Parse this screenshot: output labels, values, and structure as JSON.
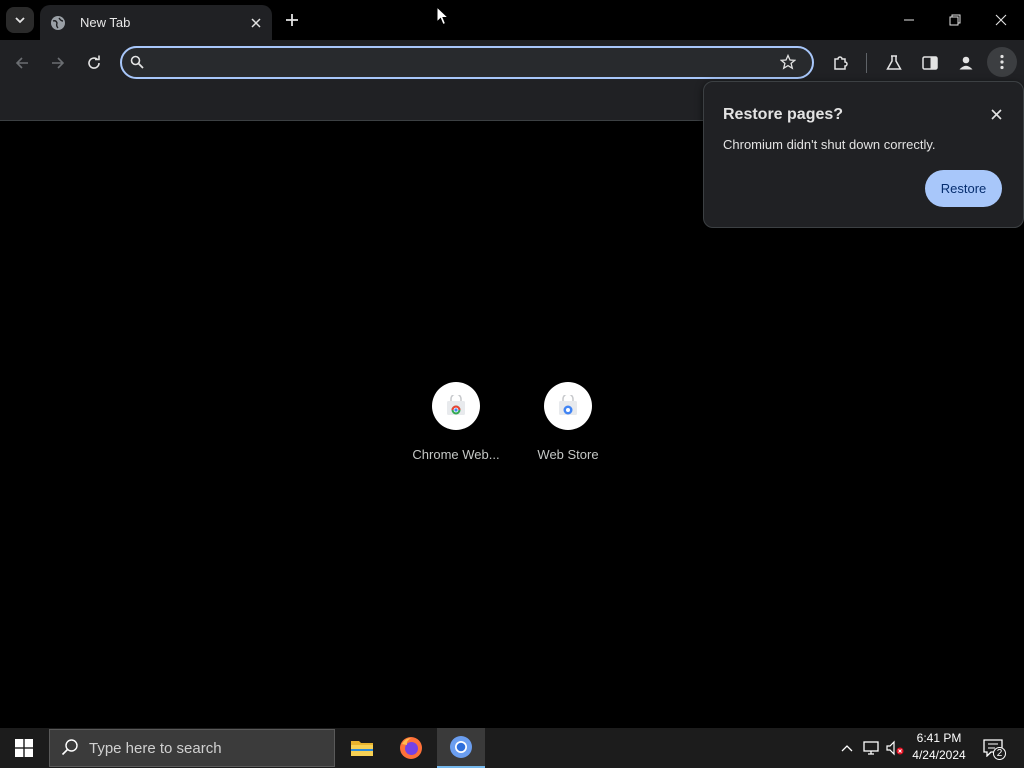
{
  "browser": {
    "tab": {
      "title": "New Tab"
    },
    "omnibox": {
      "value": "",
      "placeholder": ""
    }
  },
  "icons": {
    "tab_search": "chevron-down-icon",
    "favicon": "globe-icon",
    "tab_close": "close-icon",
    "new_tab": "plus-icon",
    "back": "arrow-left-icon",
    "forward": "arrow-right-icon",
    "reload": "reload-icon",
    "omnibox_search": "search-icon",
    "bookmark": "star-icon",
    "extensions": "puzzle-icon",
    "labs": "flask-icon",
    "side_panel": "side-panel-icon",
    "profile": "person-icon",
    "menu": "kebab-menu-icon"
  },
  "shortcuts": [
    {
      "label": "Chrome Web..."
    },
    {
      "label": "Web Store"
    }
  ],
  "restore_bubble": {
    "title": "Restore pages?",
    "message": "Chromium didn't shut down correctly.",
    "button": "Restore"
  },
  "taskbar": {
    "search_placeholder": "Type here to search",
    "apps": [
      "File Explorer",
      "Firefox",
      "Chromium"
    ],
    "clock": {
      "time": "6:41 PM",
      "date": "4/24/2024"
    },
    "notification_count": "2"
  },
  "colors": {
    "accent": "#a8c7fa",
    "toolbar": "#202124",
    "content_bg": "#000000",
    "taskbar": "#1c1c1c"
  }
}
